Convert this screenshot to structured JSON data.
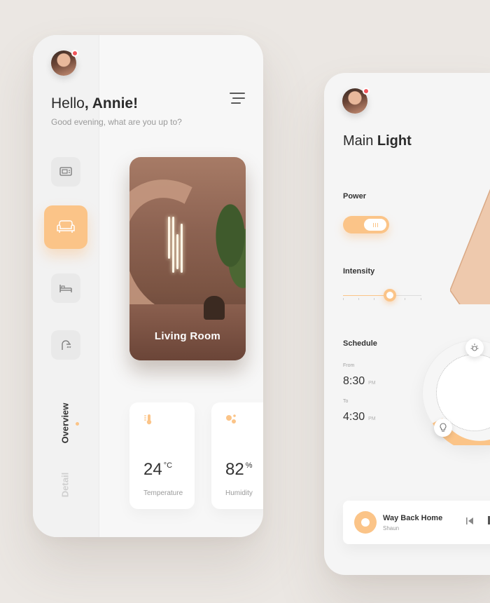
{
  "left": {
    "greeting_prefix": "Hello",
    "greeting_name": ", Annie!",
    "subtitle": "Good evening, what are you up to?",
    "rooms": [
      {
        "icon": "tv-icon",
        "active": false
      },
      {
        "icon": "sofa-icon",
        "active": true
      },
      {
        "icon": "bed-icon",
        "active": false
      },
      {
        "icon": "shower-icon",
        "active": false
      }
    ],
    "nav": {
      "overview": "Overview",
      "detail": "Detail"
    },
    "room_card": {
      "label": "Living Room"
    },
    "stats": [
      {
        "value": "24",
        "unit": "°C",
        "caption": "Temperature",
        "icon": "thermometer-icon"
      },
      {
        "value": "82",
        "unit": "%",
        "caption": "Humidity",
        "icon": "humidity-icon"
      }
    ]
  },
  "right": {
    "title_prefix": "Main ",
    "title_bold": "Light",
    "power_label": "Power",
    "power_on": true,
    "intensity_label": "Intensity",
    "intensity_level": 0.6,
    "schedule_label": "Schedule",
    "from_label": "From",
    "from_time": "8:30",
    "from_meridiem": "PM",
    "to_label": "To",
    "to_time": "4:30",
    "to_meridiem": "PM",
    "player": {
      "song": "Way Back Home",
      "artist": "Shaun"
    }
  },
  "colors": {
    "accent": "#fbc488",
    "alert": "#f0545a",
    "background": "#ebe7e3"
  }
}
